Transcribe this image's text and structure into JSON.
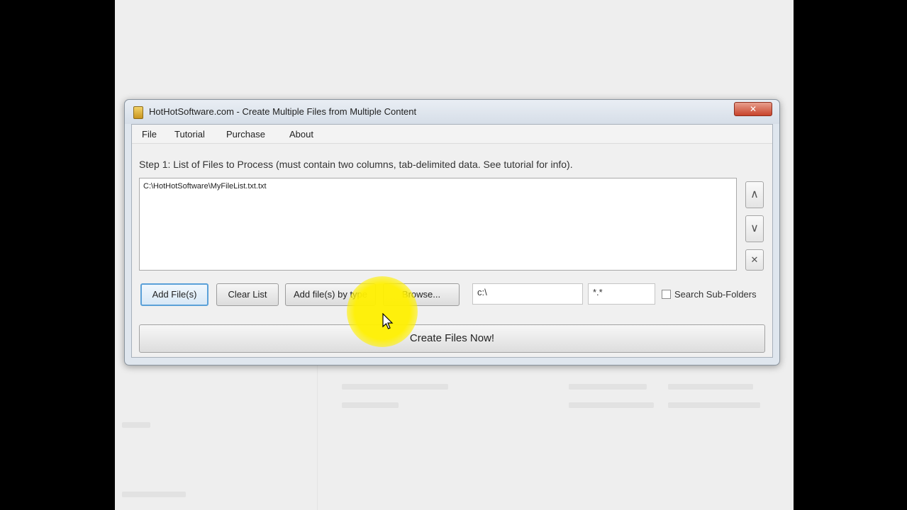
{
  "window": {
    "title": "HotHotSoftware.com - Create Multiple Files from Multiple Content",
    "close_label": "✕"
  },
  "menu": [
    {
      "label": "File"
    },
    {
      "label": "Tutorial"
    },
    {
      "label": "Purchase"
    },
    {
      "label": "About"
    }
  ],
  "step1": {
    "label": "Step 1: List of Files to Process (must contain two columns, tab-delimited data. See tutorial for info)."
  },
  "file_list": {
    "items": [
      "C:\\HotHotSoftware\\MyFileList.txt.txt"
    ]
  },
  "side_buttons": {
    "up": "∧",
    "down": "∨",
    "remove": "✕"
  },
  "buttons": {
    "add_files": "Add File(s)",
    "clear_list": "Clear List",
    "add_by_type": "Add file(s) by type",
    "browse": "Browse..."
  },
  "inputs": {
    "folder_value": "c:\\",
    "filter_value": "*.*"
  },
  "search_subfolders": {
    "label": "Search Sub-Folders",
    "checked": false
  },
  "create_button": {
    "label": "Create Files Now!"
  },
  "icons": {
    "app": "app-icon",
    "cursor": "mouse-pointer-icon"
  }
}
